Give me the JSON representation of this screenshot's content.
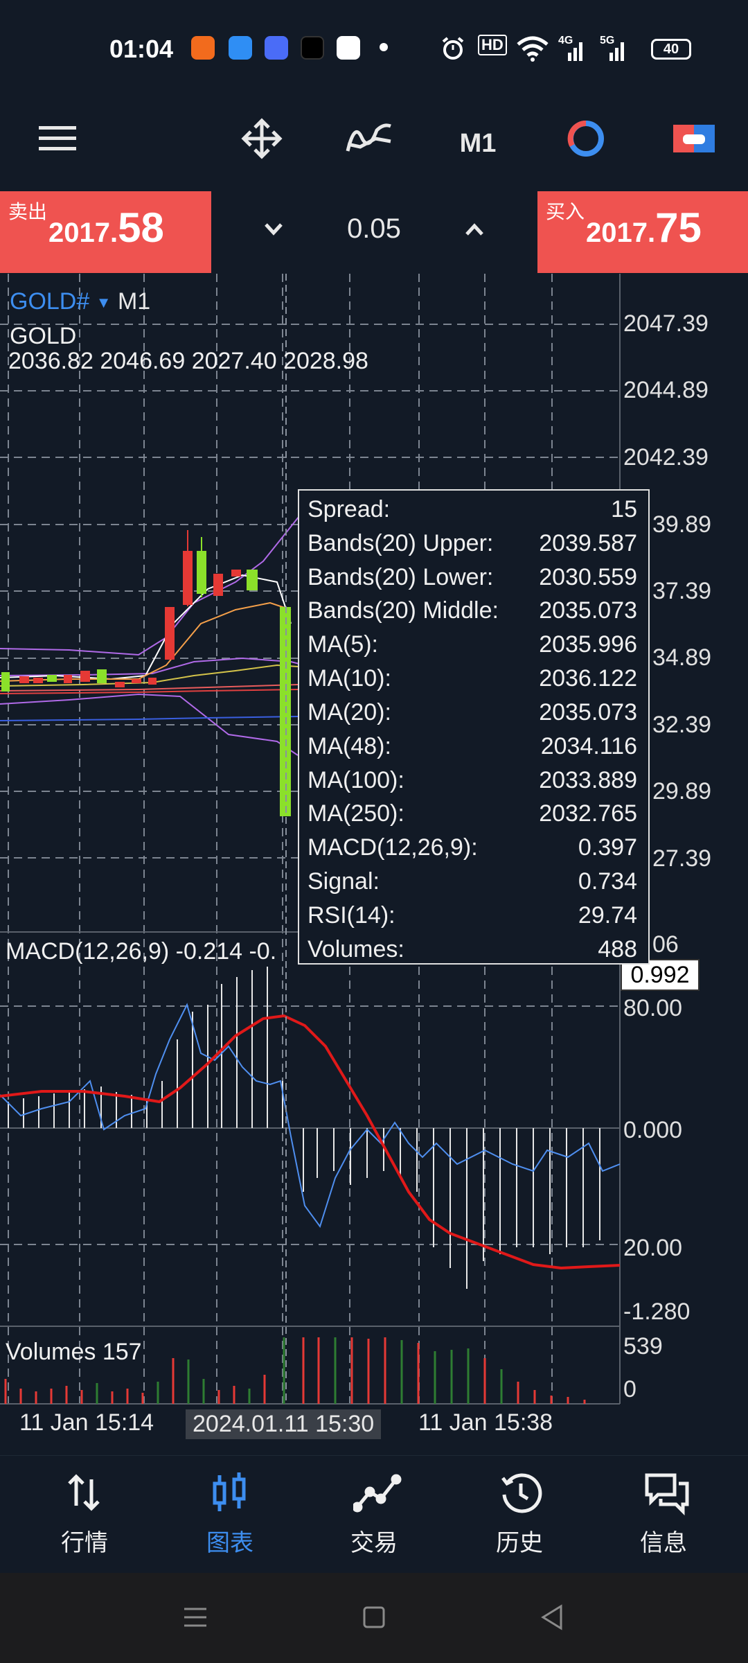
{
  "status_bar": {
    "time": "01:04",
    "hd_label": "HD",
    "net_a": "4G",
    "net_b": "5G",
    "battery": "40"
  },
  "toolbar": {
    "timeframe": "M1",
    "icons": [
      "menu-icon",
      "crosshair-move-icon",
      "indicator-icon",
      "timeframe-button",
      "clock-icon",
      "trade-toggle-icon"
    ]
  },
  "price_bar": {
    "sell_label": "卖出",
    "sell_price_small": "2017.",
    "sell_price_large": "58",
    "buy_label": "买入",
    "buy_price_small": "2017.",
    "buy_price_large": "75",
    "lot_value": "0.05",
    "colors": {
      "sell": "#ef5350",
      "buy": "#ef5350"
    }
  },
  "chart": {
    "symbol": "GOLD#",
    "timeframe": "M1",
    "description": "GOLD",
    "ohlc": "2036.82 2046.69 2027.40 2028.98",
    "price_axis": [
      "2047.39",
      "2044.89",
      "2042.39",
      "39.89",
      "37.39",
      "34.89",
      "32.39",
      "29.89",
      "27.39"
    ],
    "macd_label": "MACD(12,26,9) -0.214 -0.",
    "macd_axis_top_partial": "06",
    "macd_cursor_value": "0.992",
    "macd_axis": [
      "80.00",
      "0.000",
      "20.00",
      "-1.280"
    ],
    "volume_label": "Volumes 157",
    "volume_axis": [
      "539",
      "0"
    ],
    "time_labels": [
      "11 Jan 15:14",
      "2024.01.11 15:30",
      "11 Jan 15:38"
    ]
  },
  "tooltip": {
    "rows": [
      {
        "k": "Spread:",
        "v": "15"
      },
      {
        "k": "Bands(20) Upper:",
        "v": "2039.587"
      },
      {
        "k": "Bands(20) Lower:",
        "v": "2030.559"
      },
      {
        "k": "Bands(20) Middle:",
        "v": "2035.073"
      },
      {
        "k": "MA(5):",
        "v": "2035.996"
      },
      {
        "k": "MA(10):",
        "v": "2036.122"
      },
      {
        "k": "MA(20):",
        "v": "2035.073"
      },
      {
        "k": "MA(48):",
        "v": "2034.116"
      },
      {
        "k": "MA(100):",
        "v": "2033.889"
      },
      {
        "k": "MA(250):",
        "v": "2032.765"
      },
      {
        "k": "MACD(12,26,9):",
        "v": "0.397"
      },
      {
        "k": "Signal:",
        "v": "0.734"
      },
      {
        "k": "RSI(14):",
        "v": "29.74"
      },
      {
        "k": "Volumes:",
        "v": "488"
      }
    ]
  },
  "bottom_nav": {
    "items": [
      {
        "label": "行情",
        "icon": "quotes-arrows-icon",
        "active": false
      },
      {
        "label": "图表",
        "icon": "chart-candles-icon",
        "active": true
      },
      {
        "label": "交易",
        "icon": "trade-line-icon",
        "active": false
      },
      {
        "label": "历史",
        "icon": "history-clock-icon",
        "active": false
      },
      {
        "label": "信息",
        "icon": "messages-icon",
        "active": false
      }
    ]
  }
}
